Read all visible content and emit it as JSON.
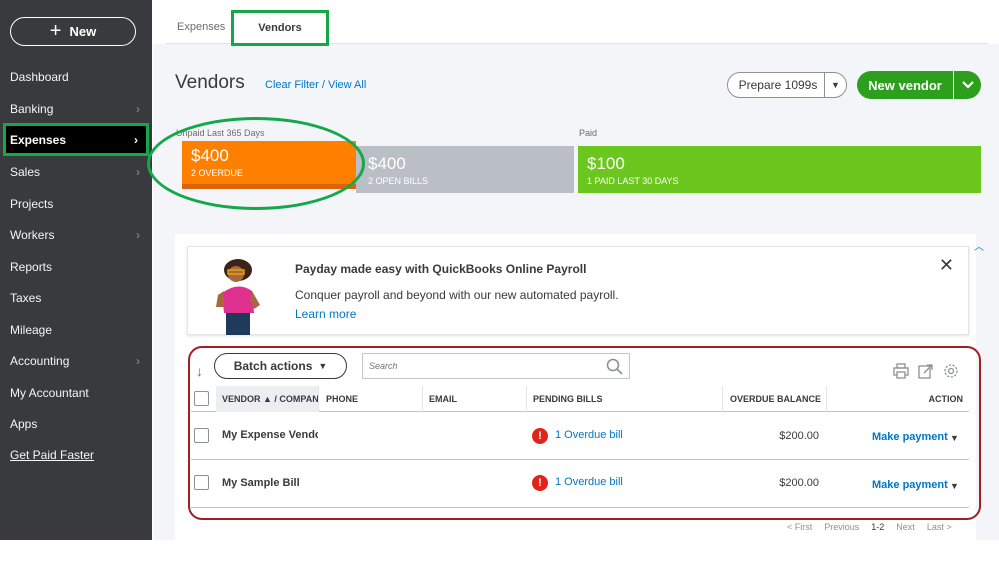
{
  "sidebar": {
    "new_label": "New",
    "items": [
      {
        "label": "Dashboard",
        "chevron": false
      },
      {
        "label": "Banking",
        "chevron": true
      },
      {
        "label": "Expenses",
        "chevron": true,
        "active": true
      },
      {
        "label": "Sales",
        "chevron": true
      },
      {
        "label": "Projects",
        "chevron": false
      },
      {
        "label": "Workers",
        "chevron": true
      },
      {
        "label": "Reports",
        "chevron": false
      },
      {
        "label": "Taxes",
        "chevron": false
      },
      {
        "label": "Mileage",
        "chevron": false
      },
      {
        "label": "Accounting",
        "chevron": true
      },
      {
        "label": "My Accountant",
        "chevron": false
      },
      {
        "label": "Apps",
        "chevron": false
      },
      {
        "label": "Get Paid Faster",
        "chevron": false,
        "link": true
      }
    ]
  },
  "tabs": [
    {
      "label": "Expenses"
    },
    {
      "label": "Vendors",
      "active": true
    }
  ],
  "header": {
    "title": "Vendors",
    "clear_filter": "Clear Filter / View All",
    "prepare_label": "Prepare 1099s",
    "new_vendor_label": "New vendor"
  },
  "money_bar": {
    "unpaid_label": "Unpaid Last 365 Days",
    "paid_label": "Paid",
    "overdue_amount": "$400",
    "overdue_sub": "2 OVERDUE",
    "open_amount": "$400",
    "open_sub": "2 OPEN BILLS",
    "paid_amount": "$100",
    "paid_sub": "1 PAID LAST 30 DAYS"
  },
  "promo": {
    "title": "Payday made easy with QuickBooks Online Payroll",
    "text": "Conquer payroll and beyond with our new automated payroll.",
    "link": "Learn more",
    "close": "✕"
  },
  "table": {
    "batch_label": "Batch actions",
    "search_placeholder": "Search",
    "columns": {
      "vendor": "VENDOR ▲ / COMPANY",
      "phone": "PHONE",
      "email": "EMAIL",
      "pending": "PENDING BILLS",
      "overdue": "OVERDUE BALANCE",
      "action": "ACTION"
    },
    "rows": [
      {
        "vendor": "My Expense Vendor",
        "phone": "",
        "email": "",
        "pending": "1 Overdue bill",
        "overdue": "$200.00",
        "action": "Make payment"
      },
      {
        "vendor": "My Sample Bill",
        "phone": "",
        "email": "",
        "pending": "1 Overdue bill",
        "overdue": "$200.00",
        "action": "Make payment"
      }
    ]
  },
  "pager": {
    "first": "< First",
    "previous": "Previous",
    "current": "1-2",
    "next": "Next",
    "last": "Last >"
  },
  "colors": {
    "sidebar_bg": "#393a3d",
    "overdue": "#ff8000",
    "open": "#babec5",
    "paid": "#6bc71e",
    "primary_green": "#2ca01c",
    "link_blue": "#0077c5",
    "alert_red": "#e2231a",
    "highlight_green": "#14a84a",
    "highlight_red": "#a01f22"
  }
}
